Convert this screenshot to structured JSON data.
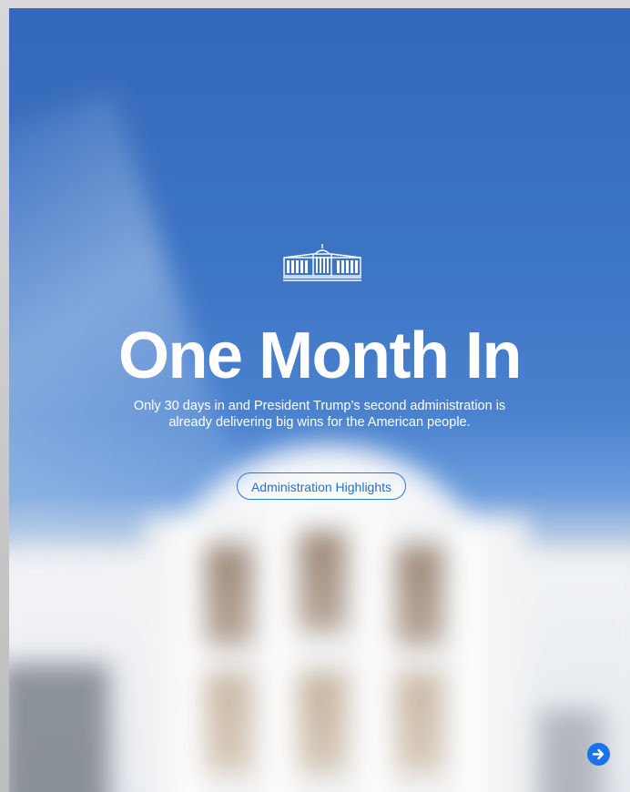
{
  "hero": {
    "logo_icon": "white-house-icon",
    "headline": "One Month In",
    "subtext": "Only 30 days in and President Trump’s second administration is already delivering big wins for the American people.",
    "cta_label": "Administration Highlights",
    "next_icon": "arrow-right-circle-icon"
  },
  "colors": {
    "sky": "#3c74c4",
    "accent": "#1a73e8",
    "text": "#ffffff"
  }
}
